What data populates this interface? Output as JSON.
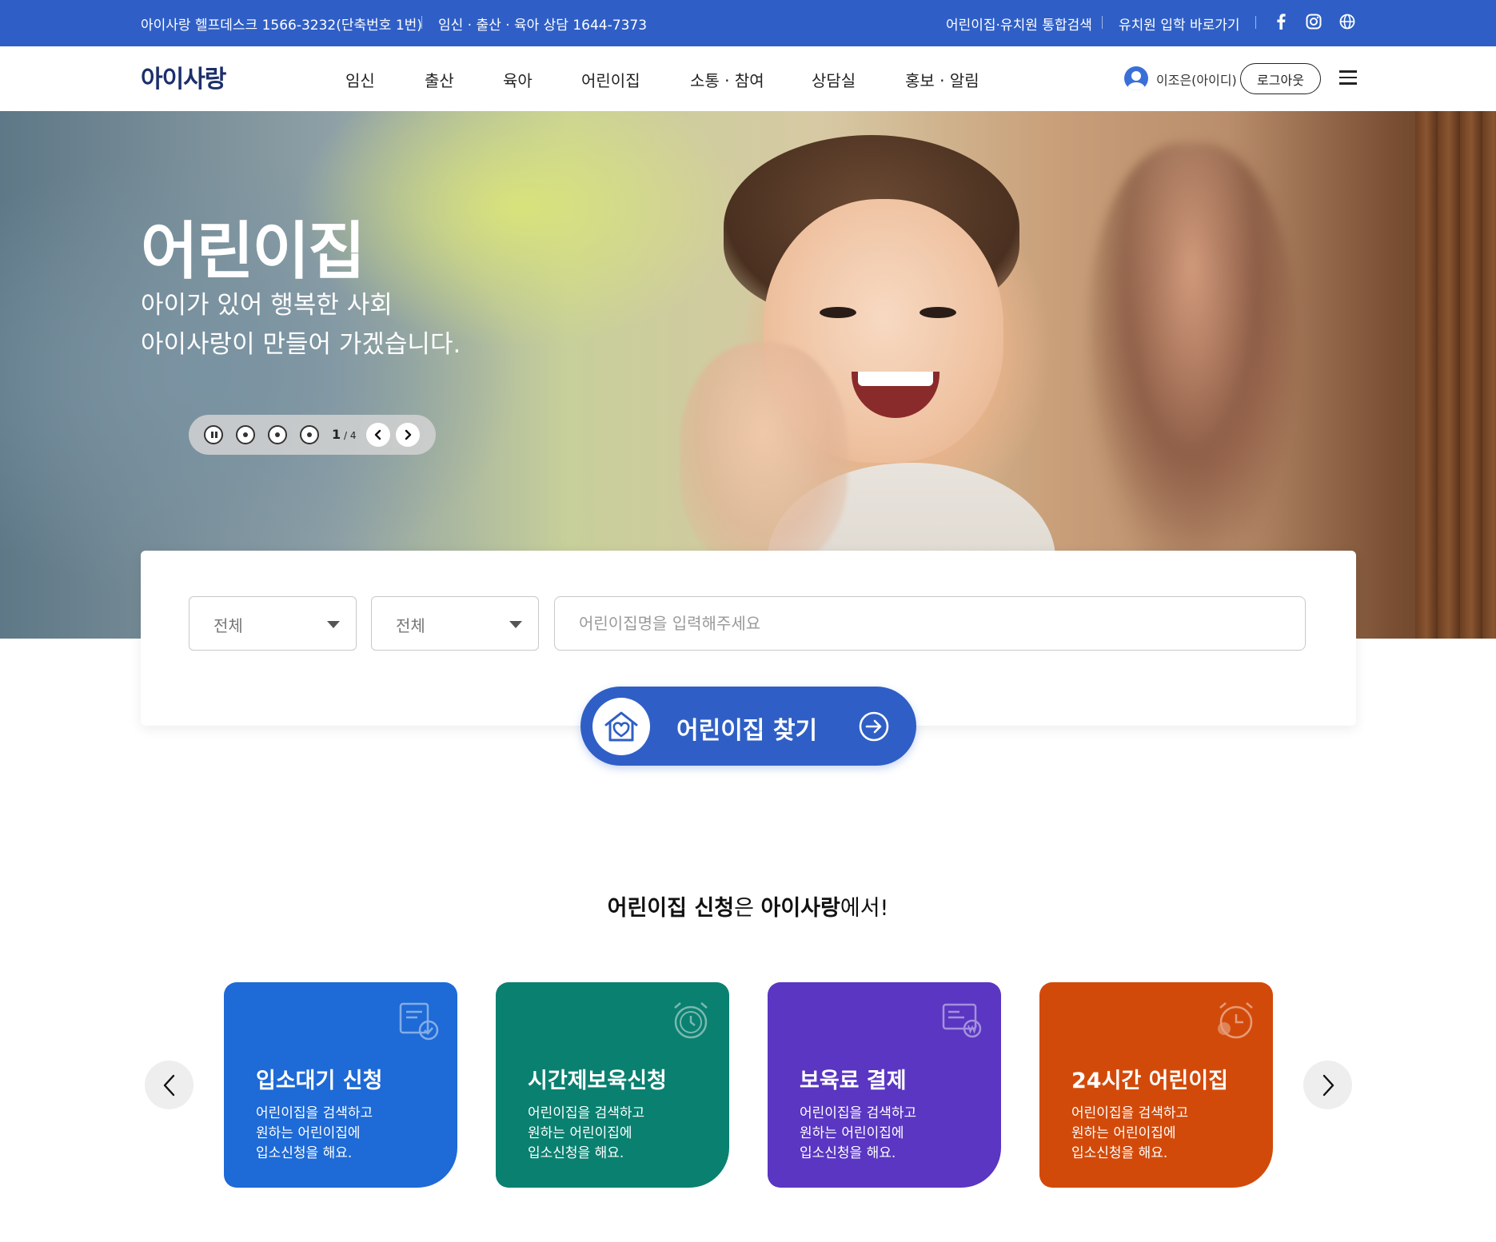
{
  "topbar": {
    "helpdesk": "아이사랑 헬프데스크 1566-3232(단축번호 1번)",
    "counsel": "임신 · 출산 · 육아 상담 1644-7373",
    "integrated_search": "어린이집·유치원 통합검색",
    "kindergarten_link": "유치원 입학 바로가기",
    "icons": [
      "facebook-icon",
      "instagram-icon",
      "globe-icon"
    ]
  },
  "header": {
    "logo": "아이사랑",
    "nav": [
      "임신",
      "출산",
      "육아",
      "어린이집",
      "소통 · 참여",
      "상담실",
      "홍보 · 알림"
    ],
    "user_name": "이조은(아이디)",
    "logout": "로그아웃"
  },
  "hero": {
    "title": "어린이집",
    "subtitle_line1": "아이가 있어 행복한 사회",
    "subtitle_line2": "아이사랑이 만들어 가겠습니다.",
    "slide_current": "1",
    "slide_total": "4"
  },
  "search": {
    "select1": "전체",
    "select2": "전체",
    "name_placeholder": "어린이집명을 입력해주세요",
    "find_button": "어린이집 찾기"
  },
  "section": {
    "title_bold1": "어린이집 신청",
    "title_normal1": "은 ",
    "title_bold2": "아이사랑",
    "title_normal2": "에서!"
  },
  "cards": [
    {
      "title": "입소대기 신청",
      "desc": "어린이집을 검색하고\n원하는 어린이집에\n입소신청을 해요.",
      "color": "#1e6ad6",
      "icon": "application-check-icon"
    },
    {
      "title": "시간제보육신청",
      "desc": "어린이집을 검색하고\n원하는 어린이집에\n입소신청을 해요.",
      "color": "#0a8070",
      "icon": "alarm-clock-icon"
    },
    {
      "title": "보육료 결제",
      "desc": "어린이집을 검색하고\n원하는 어린이집에\n입소신청을 해요.",
      "color": "#5a36c2",
      "icon": "payment-card-icon"
    },
    {
      "title": "24시간 어린이집",
      "desc": "어린이집을 검색하고\n원하는 어린이집에\n입소신청을 해요.",
      "color": "#d24a0a",
      "icon": "24-hour-clock-icon"
    }
  ],
  "colors": {
    "primary": "#2f5fc6"
  }
}
